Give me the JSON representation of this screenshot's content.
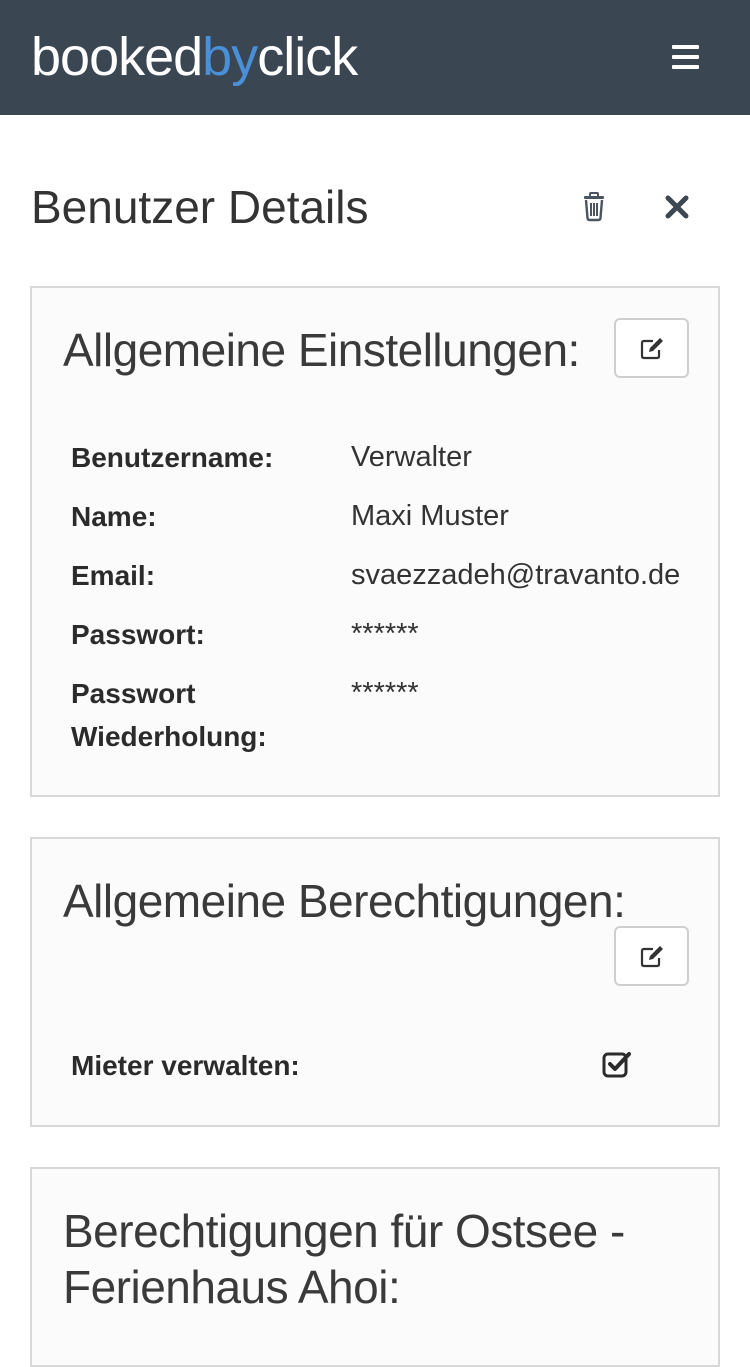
{
  "header": {
    "logo_part1": "booked",
    "logo_part2": "by",
    "logo_part3": "click",
    "menu_icon": "hamburger-menu-icon"
  },
  "page": {
    "title": "Benutzer Details",
    "delete_icon": "trash-icon",
    "close_icon": "close-icon"
  },
  "general_settings": {
    "title": "Allgemeine Einstellungen:",
    "edit_icon": "edit-icon",
    "fields": [
      {
        "label": "Benutzername:",
        "value": "Verwalter"
      },
      {
        "label": "Name:",
        "value": "Maxi Muster"
      },
      {
        "label": "Email:",
        "value": "svaezzadeh@travanto.de"
      },
      {
        "label": "Passwort:",
        "value": "******"
      },
      {
        "label": "Passwort Wiederholung:",
        "value": "******"
      }
    ]
  },
  "general_permissions": {
    "title": "Allgemeine Berechtigungen:",
    "edit_icon": "edit-icon",
    "items": [
      {
        "label": "Mieter verwalten:",
        "checked": true
      }
    ]
  },
  "property_permissions": {
    "title": "Berechtigungen für Ostsee - Ferienhaus Ahoi:"
  },
  "colors": {
    "header_bg": "#3a4652",
    "logo_accent": "#4a90d9",
    "panel_border": "#d8d8d8"
  }
}
